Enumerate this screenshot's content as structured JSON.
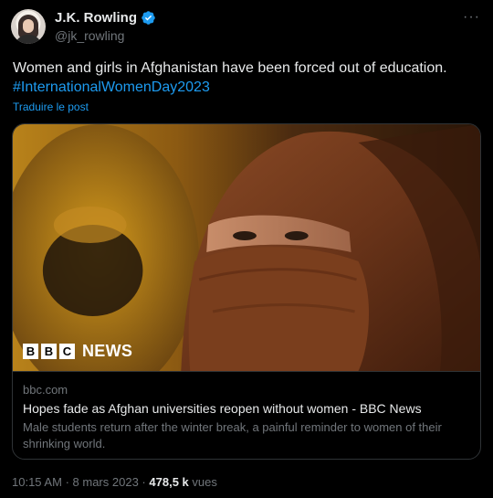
{
  "author": {
    "display_name": "J.K. Rowling",
    "handle": "@jk_rowling",
    "verified_color": "#1d9bf0"
  },
  "more_label": "···",
  "tweet": {
    "text": "Women and girls in Afghanistan have been forced out of education.",
    "hashtag": "#InternationalWomenDay2023",
    "translate_label": "Traduire le post"
  },
  "card": {
    "logo_letters": [
      "B",
      "B",
      "C"
    ],
    "logo_word": "NEWS",
    "domain": "bbc.com",
    "title": "Hopes fade as Afghan universities reopen without women - BBC News",
    "description": "Male students return after the winter break, a painful reminder to women of their shrinking world."
  },
  "footer": {
    "time": "10:15 AM",
    "separator": "·",
    "date": "8 mars 2023",
    "views_count": "478,5 k",
    "views_label": "vues"
  },
  "colors": {
    "background": "#000000",
    "text": "#e7e9ea",
    "muted": "#71767b",
    "accent": "#1d9bf0",
    "border": "#2f3336"
  }
}
